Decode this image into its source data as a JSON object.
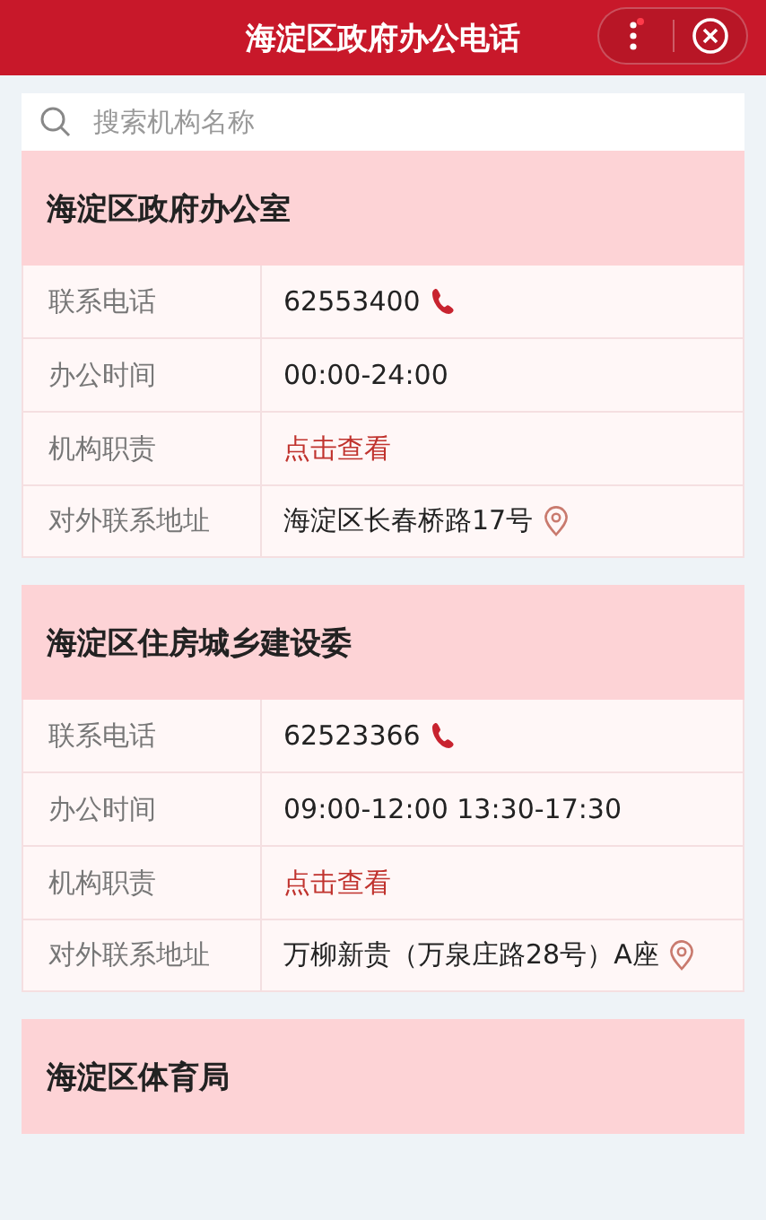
{
  "header": {
    "title": "海淀区政府办公电话",
    "menu_badge": true
  },
  "search": {
    "placeholder": "搜索机构名称"
  },
  "orgs": [
    {
      "name": "海淀区政府办公室",
      "rows": [
        {
          "kind": "phone",
          "label": "联系电话",
          "value": "62553400"
        },
        {
          "kind": "text",
          "label": "办公时间",
          "value": "00:00-24:00"
        },
        {
          "kind": "link",
          "label": "机构职责",
          "value": "点击查看"
        },
        {
          "kind": "address",
          "label": "对外联系地址",
          "value": "海淀区长春桥路17号"
        }
      ]
    },
    {
      "name": "海淀区住房城乡建设委",
      "rows": [
        {
          "kind": "phone",
          "label": "联系电话",
          "value": "62523366"
        },
        {
          "kind": "text",
          "label": "办公时间",
          "value": "09:00-12:00 13:30-17:30"
        },
        {
          "kind": "link",
          "label": "机构职责",
          "value": "点击查看"
        },
        {
          "kind": "address",
          "label": "对外联系地址",
          "value": "万柳新贵（万泉庄路28号）A座"
        }
      ]
    },
    {
      "name": "海淀区体育局"
    }
  ]
}
